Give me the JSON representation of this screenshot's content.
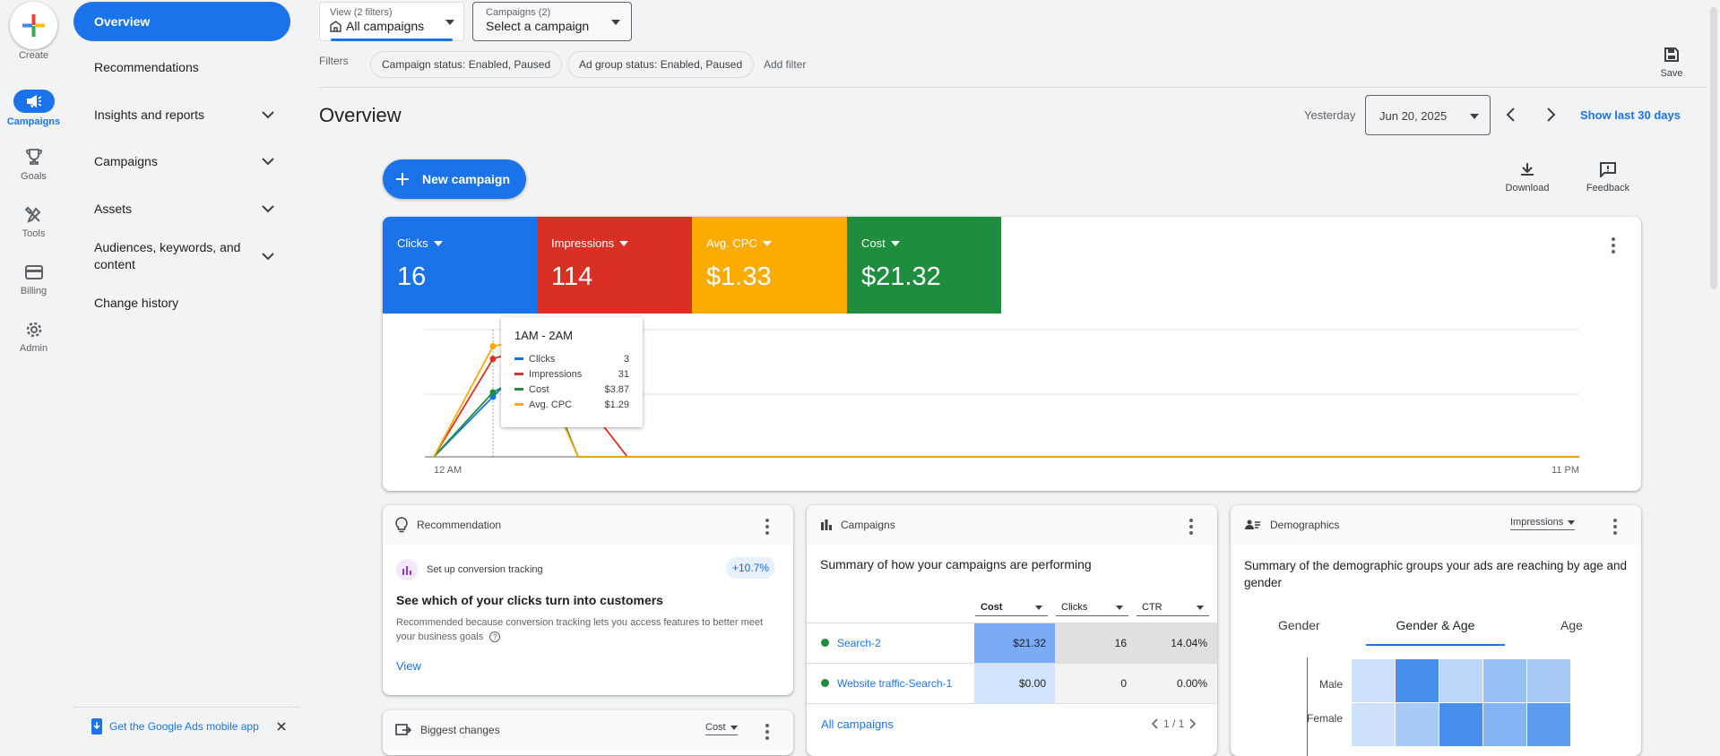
{
  "rail": {
    "create": "Create",
    "items": [
      {
        "label": "Campaigns",
        "icon": "megaphone-icon"
      },
      {
        "label": "Goals",
        "icon": "trophy-icon"
      },
      {
        "label": "Tools",
        "icon": "tools-icon"
      },
      {
        "label": "Billing",
        "icon": "credit-card-icon"
      },
      {
        "label": "Admin",
        "icon": "gear-icon"
      }
    ]
  },
  "nav": {
    "items": [
      {
        "label": "Overview"
      },
      {
        "label": "Recommendations"
      },
      {
        "label": "Insights and reports"
      },
      {
        "label": "Campaigns"
      },
      {
        "label": "Assets"
      },
      {
        "label": "Audiences, keywords, and content"
      },
      {
        "label": "Change history"
      }
    ],
    "mobile_app": "Get the Google Ads mobile app"
  },
  "topbar": {
    "view_label": "View (2 filters)",
    "view_value": "All campaigns",
    "campaigns_label": "Campaigns (2)",
    "campaigns_value": "Select a campaign",
    "filters_label": "Filters",
    "chips": [
      "Campaign status: Enabled, Paused",
      "Ad group status: Enabled, Paused"
    ],
    "add_filter": "Add filter",
    "save": "Save"
  },
  "header": {
    "title": "Overview",
    "date_prefix": "Yesterday",
    "date_value": "Jun 20, 2025",
    "show_last": "Show last 30 days",
    "new_campaign": "New campaign",
    "download": "Download",
    "feedback": "Feedback"
  },
  "colors": {
    "blue": "#1a73e8",
    "red": "#d93025",
    "yellow": "#f9ab00",
    "green": "#1e8e3e"
  },
  "metrics": [
    {
      "label": "Clicks",
      "value": "16",
      "color": "#1a73e8"
    },
    {
      "label": "Impressions",
      "value": "114",
      "color": "#d93025"
    },
    {
      "label": "Avg. CPC",
      "value": "$1.33",
      "color": "#f9ab00"
    },
    {
      "label": "Cost",
      "value": "$21.32",
      "color": "#1e8e3e"
    }
  ],
  "chart_data": {
    "type": "line",
    "x_start_label": "12 AM",
    "x_end_label": "11 PM",
    "series": [
      {
        "name": "Clicks",
        "color": "#1a73e8",
        "values": [
          0,
          3,
          4,
          6,
          0,
          0,
          0
        ]
      },
      {
        "name": "Impressions",
        "color": "#d93025",
        "values": [
          0,
          31,
          33,
          38,
          20,
          0,
          0
        ]
      },
      {
        "name": "Cost",
        "color": "#1e8e3e",
        "values": [
          0,
          3.87,
          4.5,
          7.2,
          0,
          0,
          0
        ]
      },
      {
        "name": "Avg. CPC",
        "color": "#f9ab00",
        "values": [
          0,
          1.29,
          1.33,
          1.3,
          0,
          0,
          0
        ]
      }
    ],
    "tooltip": {
      "title": "1AM - 2AM",
      "rows": [
        {
          "name": "Clicks",
          "value": "3",
          "color": "#1a73e8"
        },
        {
          "name": "Impressions",
          "value": "31",
          "color": "#d93025"
        },
        {
          "name": "Cost",
          "value": "$3.87",
          "color": "#1e8e3e"
        },
        {
          "name": "Avg. CPC",
          "value": "$1.29",
          "color": "#f9ab00"
        }
      ]
    }
  },
  "recommendation": {
    "header": "Recommendation",
    "item": "Set up conversion tracking",
    "badge": "+10.7%",
    "title": "See which of your clicks turn into customers",
    "body": "Recommended because conversion tracking lets you access features to better meet your business goals",
    "view": "View"
  },
  "campaigns_card": {
    "header": "Campaigns",
    "summary": "Summary of how your campaigns are performing",
    "columns": [
      "Cost",
      "Clicks",
      "CTR"
    ],
    "rows": [
      {
        "name": "Search-2",
        "cost": "$21.32",
        "clicks": "16",
        "ctr": "14.04%",
        "status_color": "#1e8e3e"
      },
      {
        "name": "Website traffic-Search-1",
        "cost": "$0.00",
        "clicks": "0",
        "ctr": "0.00%",
        "status_color": "#1e8e3e"
      }
    ],
    "all_link": "All campaigns",
    "pager": "1 / 1"
  },
  "demographics": {
    "header": "Demographics",
    "metric_select": "Impressions",
    "summary": "Summary of the demographic groups your ads are reaching by age and gender",
    "tabs": [
      "Gender",
      "Gender & Age",
      "Age"
    ],
    "rows": [
      "Male",
      "Female"
    ],
    "heat": [
      [
        0.1,
        0.8,
        0.2,
        0.4,
        0.3
      ],
      [
        0.1,
        0.3,
        0.8,
        0.5,
        0.7
      ]
    ]
  },
  "biggest_changes": {
    "header": "Biggest changes",
    "metric_select": "Cost"
  }
}
